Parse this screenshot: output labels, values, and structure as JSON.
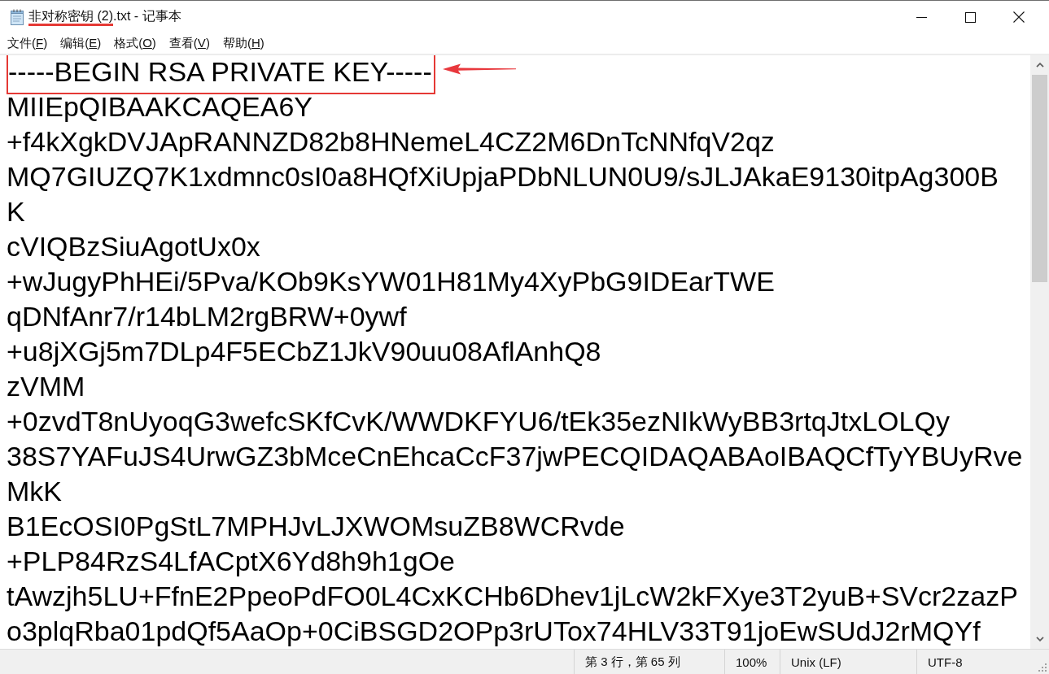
{
  "window": {
    "title_parts": [
      {
        "text": "非对称密钥 (2)",
        "underlined": true
      },
      {
        "text": ".txt - 记事本",
        "underlined": false
      }
    ]
  },
  "menu": [
    {
      "label": "文件(",
      "key": "F",
      "tail": ")"
    },
    {
      "label": "编辑(",
      "key": "E",
      "tail": ")"
    },
    {
      "label": "格式(",
      "key": "O",
      "tail": ")"
    },
    {
      "label": "查看(",
      "key": "V",
      "tail": ")"
    },
    {
      "label": "帮助(",
      "key": "H",
      "tail": ")"
    }
  ],
  "editor": {
    "lines": [
      {
        "text": "-----BEGIN RSA PRIVATE KEY-----",
        "highlighted": true
      },
      {
        "text": "MIIEpQIBAAKCAQEA6Y",
        "highlighted": false
      },
      {
        "text": "+f4kXgkDVJApRANNZD82b8HNemeL4CZ2M6DnTcNNfqV2qz",
        "highlighted": false
      },
      {
        "text": "MQ7GIUZQ7K1xdmnc0sI0a8HQfXiUpjaPDbNLUN0U9/sJLJAkaE9130itpAg300B",
        "highlighted": false
      },
      {
        "text": "K",
        "highlighted": false
      },
      {
        "text": "cVIQBzSiuAgotUx0x",
        "highlighted": false
      },
      {
        "text": "+wJugyPhHEi/5Pva/KOb9KsYW01H81My4XyPbG9IDEarTWE",
        "highlighted": false
      },
      {
        "text": "qDNfAnr7/r14bLM2rgBRW+0ywf",
        "highlighted": false
      },
      {
        "text": "+u8jXGj5m7DLp4F5ECbZ1JkV90uu08AflAnhQ8",
        "highlighted": false
      },
      {
        "text": "zVMM",
        "highlighted": false
      },
      {
        "text": "+0zvdT8nUyoqG3wefcSKfCvK/WWDKFYU6/tEk35ezNIkWyBB3rtqJtxLOLQy",
        "highlighted": false
      },
      {
        "text": "38S7YAFuJS4UrwGZ3bMceCnEhcaCcF37jwPECQIDAQABAoIBAQCfTyYBUyRve",
        "highlighted": false
      },
      {
        "text": "MkK",
        "highlighted": false
      },
      {
        "text": "B1EcOSI0PgStL7MPHJvLJXWOMsuZB8WCRvde",
        "highlighted": false
      },
      {
        "text": "+PLP84RzS4LfACptX6Yd8h9h1gOe",
        "highlighted": false
      },
      {
        "text": "tAwzjh5LU+FfnE2PpeoPdFO0L4CxKCHb6Dhev1jLcW2kFXye3T2yuB+SVcr2zazP",
        "highlighted": false
      },
      {
        "text": "o3plqRba01pdQf5AaOp+0CiBSGD2OPp3rUTox74HLV33T91joEwSUdJ2rMQYf",
        "highlighted": false
      }
    ]
  },
  "status_bar": {
    "position": "第 3 行，第 65 列",
    "zoom": "100%",
    "line_ending": "Unix (LF)",
    "encoding": "UTF-8"
  }
}
